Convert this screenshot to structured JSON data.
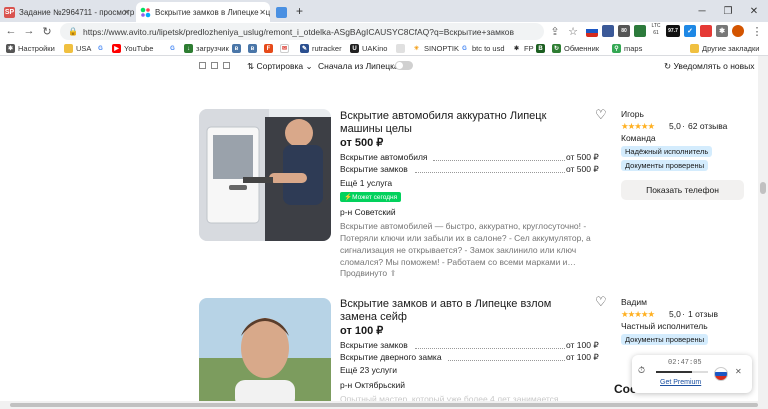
{
  "browser": {
    "tabs": [
      {
        "title": "Задание №2964711 - просмотр з",
        "favicon": "SP",
        "color": "#d9534f"
      },
      {
        "title": "Вскрытие замков в Липецке - це",
        "favicon": "av",
        "color": "#0af",
        "active": true
      },
      {
        "title": "",
        "favicon": "",
        "color": "#4a90e2"
      }
    ],
    "new_tab": "+",
    "url": "https://www.avito.ru/lipetsk/predlozheniya_uslug/remont_i_otdelka-ASgBAgICAUSYC8CfAQ?q=Вскрытие+замков",
    "ext_ltc_label": "LTC",
    "ext_ltc_value": "61",
    "ext_badge": "80",
    "ext_value": "97.7"
  },
  "bookmarks": [
    {
      "label": "Настройки",
      "icon": "gear-icon"
    },
    {
      "label": "USA",
      "icon": "folder-icon"
    },
    {
      "label": "",
      "icon": "google-icon"
    },
    {
      "label": "YouTube",
      "icon": "youtube-icon"
    },
    {
      "label": "",
      "icon": "google-icon"
    },
    {
      "label": "загрузчик",
      "icon": "download-icon"
    },
    {
      "label": "",
      "icon": "vk-icon"
    },
    {
      "label": "",
      "icon": "vk-icon"
    },
    {
      "label": "",
      "icon": "f-icon"
    },
    {
      "label": "",
      "icon": "mail-icon"
    },
    {
      "label": "rutracker",
      "icon": "rutracker-icon"
    },
    {
      "label": "UAKino",
      "icon": "uakino-icon"
    },
    {
      "label": "",
      "icon": "blank-icon"
    },
    {
      "label": "SINOPTIK",
      "icon": "sinoptik-icon"
    },
    {
      "label": "btc to usd",
      "icon": "google-icon"
    },
    {
      "label": "FP",
      "icon": "fp-icon"
    },
    {
      "label": "",
      "icon": "bookmark-icon"
    },
    {
      "label": "Обменник",
      "icon": "exchange-icon"
    },
    {
      "label": "maps",
      "icon": "maps-icon"
    },
    {
      "label": "Другие закладки",
      "icon": "folder-icon"
    }
  ],
  "toolbar": {
    "sort_label": "Сортировка",
    "sort_first": "Сначала из Липецка",
    "notify": "Уведомлять о новых"
  },
  "listings": [
    {
      "title": "Вскрытие автомобиля аккуратно Липецк машины целы",
      "price": "от 500 ₽",
      "services": [
        {
          "name": "Вскрытие автомобиля",
          "price": "от 500 ₽"
        },
        {
          "name": "Вскрытие замков",
          "price": "от 500 ₽"
        }
      ],
      "more": "Ещё 1 услуга",
      "badge": "Может сегодня",
      "district": "р-н Советский",
      "description": "Вскрытие автомобилей — быстро, аккуратно, круглосуточно! - Потеряли ключи или забыли их в салоне? - Сел аккумулятор, а сигнализация не открывается? - Замок заклинило или ключ сломался? Мы поможем! - Работаем со всеми марками и…",
      "bumped": "Продвинуто",
      "seller": {
        "name": "Игорь",
        "rating": "5,0",
        "reviews": "62 отзыва",
        "type": "Команда",
        "chips": [
          "Надёжный исполнитель",
          "Документы проверены"
        ]
      },
      "phone_button": "Показать телефон"
    },
    {
      "title": "Вскрытие замков и авто в Липецке взлом замена сейф",
      "price": "от 100 ₽",
      "services": [
        {
          "name": "Вскрытие замков",
          "price": "от 100 ₽"
        },
        {
          "name": "Вскрытие дверного замка",
          "price": "от 100 ₽"
        }
      ],
      "more": "Ещё 23 услуги",
      "district": "р-н Октябрьский",
      "description": "Опытный мастер, который уже более 4 лет занимается…",
      "seller": {
        "name": "Вадим",
        "rating": "5,0",
        "reviews": "1 отзыв",
        "type": "Частный исполнитель",
        "chips": [
          "Документы проверены"
        ]
      }
    }
  ],
  "popup": {
    "time": "02:47:05",
    "link": "Get Premium",
    "close": "✕"
  },
  "partial_text": "Соо"
}
